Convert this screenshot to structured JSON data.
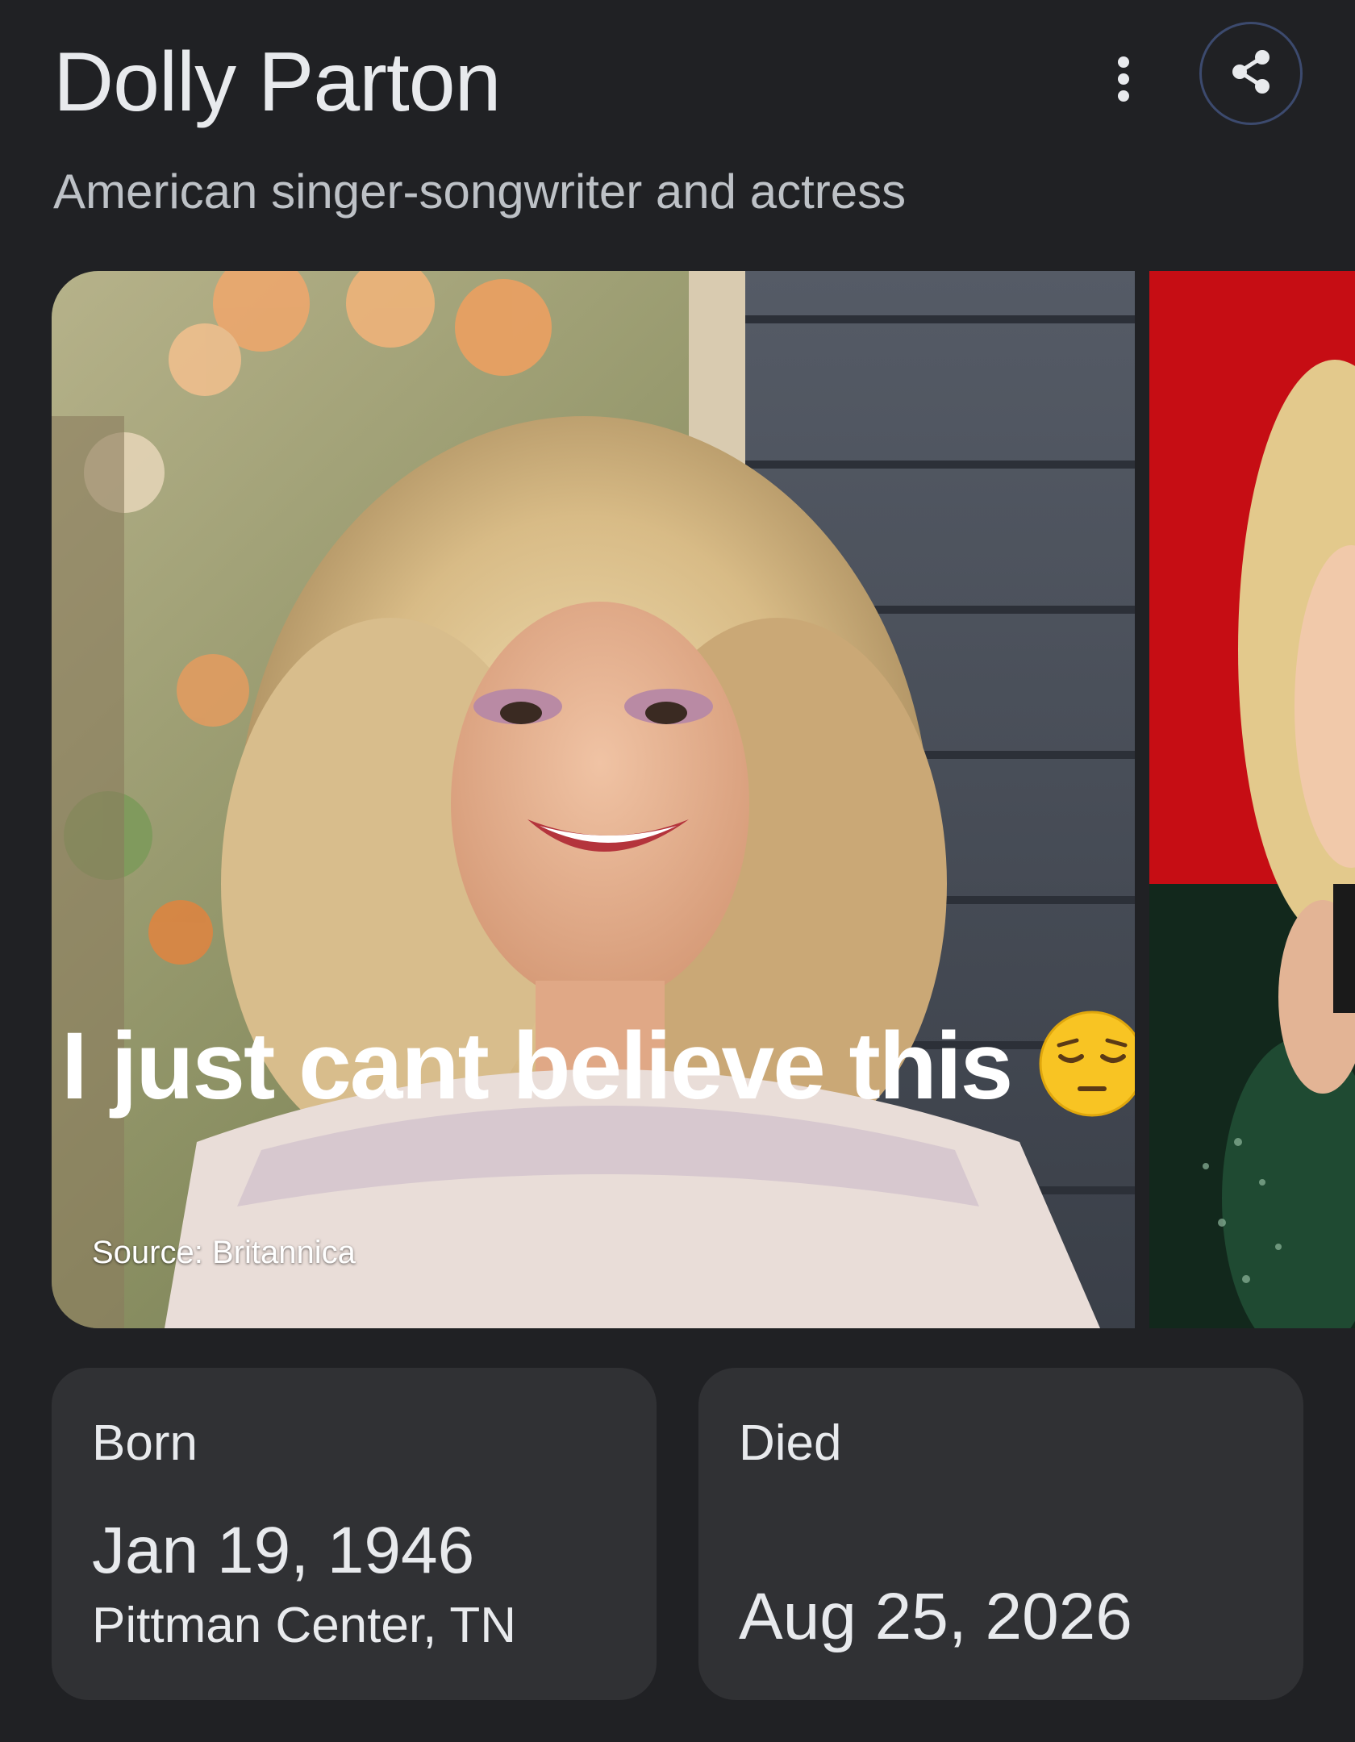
{
  "header": {
    "title": "Dolly Parton",
    "subtitle": "American singer-songwriter and actress"
  },
  "actions": {
    "more_icon": "more-vert-icon",
    "share_icon": "share-icon"
  },
  "carousel": {
    "images": [
      {
        "overlay_text": "I just cant believe this",
        "emoji": "pensive-face",
        "source_label": "Source: Britannica"
      },
      {
        "overlay_text": ""
      }
    ]
  },
  "facts": {
    "born": {
      "label": "Born",
      "value": "Jan 19, 1946",
      "place": "Pittman Center, TN"
    },
    "died": {
      "label": "Died",
      "value": "Aug 25, 2026"
    }
  },
  "colors": {
    "background": "#202124",
    "card": "#303134",
    "text": "#e8eaed",
    "secondary_text": "#bdc1c6",
    "share_border": "#3c4a6e"
  }
}
